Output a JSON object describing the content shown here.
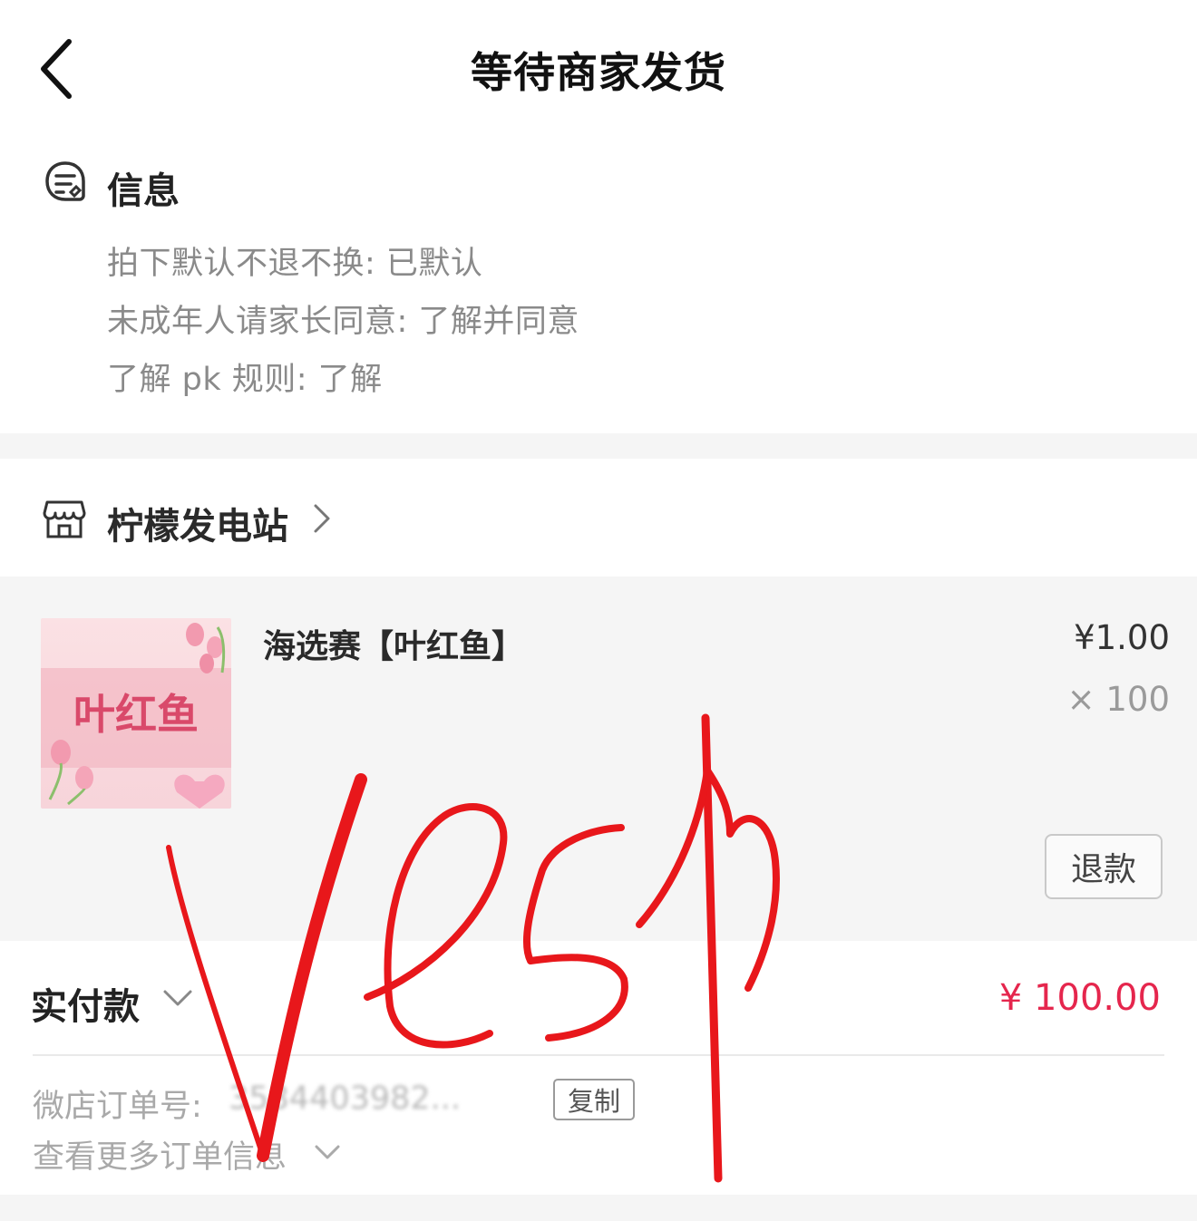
{
  "header": {
    "title": "等待商家发货",
    "back_icon": "chevron-left-icon"
  },
  "info": {
    "icon": "message-note-icon",
    "title": "信息",
    "lines": [
      "拍下默认不退不换: 已默认",
      "未成年人请家长同意: 了解并同意",
      "了解 pk 规则: 了解"
    ]
  },
  "shop": {
    "icon": "store-icon",
    "name": "柠檬发电站",
    "chevron_icon": "chevron-right-icon"
  },
  "product": {
    "thumbnail_text": "叶红鱼",
    "name": "海选赛【叶红鱼】",
    "price": "¥1.00",
    "quantity": "× 100",
    "refund_label": "退款"
  },
  "payment": {
    "label": "实付款",
    "amount": "¥ 100.00",
    "amount_color": "#e5264d",
    "order_label": "微店订单号:",
    "order_number": "3584403982...",
    "copy_label": "复制",
    "more_label": "查看更多订单信息"
  },
  "annotation": {
    "handwriting": "Vesp",
    "ink_color": "#e8171b"
  }
}
